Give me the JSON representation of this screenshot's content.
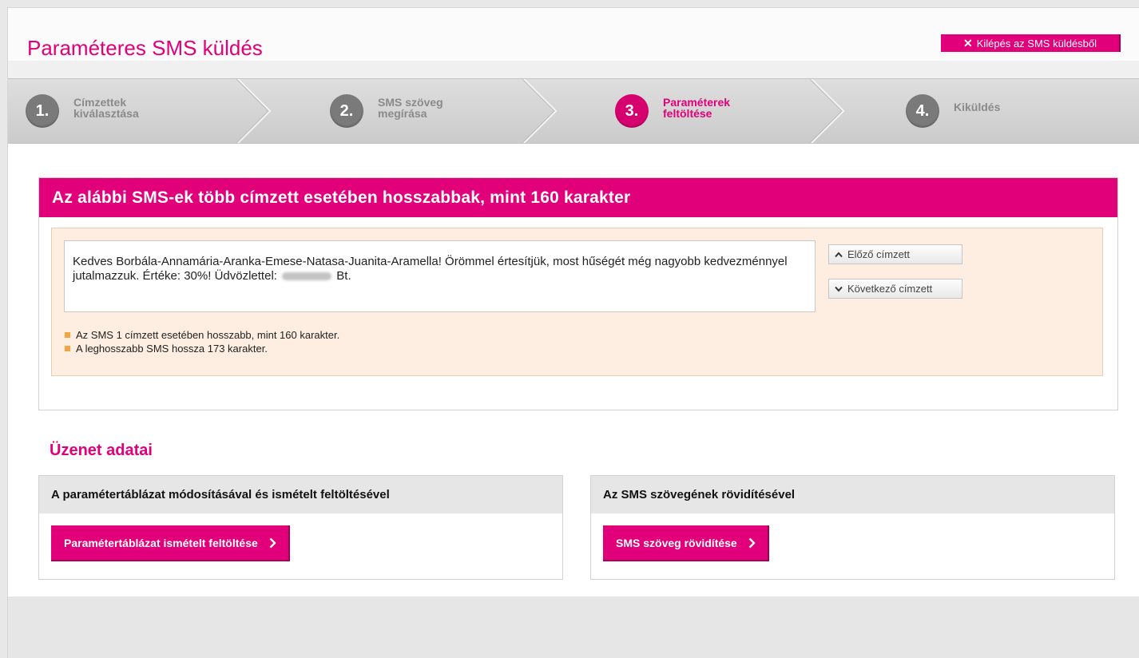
{
  "header": {
    "title": "Paraméteres SMS küldés",
    "exit_label": "Kilépés az SMS küldésből"
  },
  "steps": [
    {
      "num": "1.",
      "line1": "Címzettek",
      "line2": "kiválasztása",
      "active": false
    },
    {
      "num": "2.",
      "line1": "SMS szöveg",
      "line2": "megírása",
      "active": false
    },
    {
      "num": "3.",
      "line1": "Paraméterek",
      "line2": "feltöltése",
      "active": true
    },
    {
      "num": "4.",
      "line1": "Kiküldés",
      "line2": "",
      "active": false
    }
  ],
  "alert": {
    "title": "Az alábbi SMS-ek több címzett esetében hosszabbak, mint 160 karakter",
    "sms_text_before": "Kedves Borbála-Annamária-Aranka-Emese-Natasa-Juanita-Aramella! Örömmel értesítjük, most hűségét még nagyobb kedvezménnyel jutalmazzuk. Értéke: 30%! Üdvözlettel:",
    "sms_text_after": "Bt.",
    "prev_label": "Előző címzett",
    "next_label": "Következő címzett",
    "bullets": [
      "Az SMS 1 címzett esetében hosszabb, mint 160 karakter.",
      "A leghosszabb SMS hossza 173 karakter."
    ]
  },
  "section": {
    "title": "Üzenet adatai",
    "options": [
      {
        "heading": "A paramétertáblázat módosításával és ismételt feltöltésével",
        "button": "Paramétertáblázat ismételt feltöltése"
      },
      {
        "heading": "Az SMS szövegének rövidítésével",
        "button": "SMS szöveg rövidítése"
      }
    ]
  },
  "colors": {
    "accent": "#e2007a",
    "bullet": "#f2a541",
    "warn_bg": "#fdeee1"
  }
}
